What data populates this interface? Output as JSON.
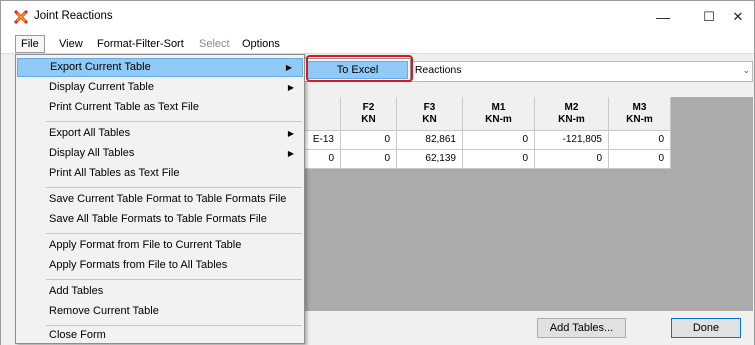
{
  "window": {
    "title": "Joint Reactions",
    "minimize_glyph": "—",
    "maximize_glyph": "☐",
    "close_glyph": "✕"
  },
  "menubar": {
    "items": [
      "File",
      "View",
      "Format-Filter-Sort",
      "Select",
      "Options"
    ]
  },
  "file_menu": {
    "items": [
      {
        "label": "Export Current Table",
        "has_submenu": true
      },
      {
        "label": "Display Current Table",
        "has_submenu": true
      },
      {
        "label": "Print Current Table as Text File",
        "has_submenu": false
      },
      {
        "label": "Export All Tables",
        "has_submenu": true
      },
      {
        "label": "Display All Tables",
        "has_submenu": true
      },
      {
        "label": "Print All Tables as Text File",
        "has_submenu": false
      },
      {
        "label": "Save Current Table Format to Table Formats File",
        "has_submenu": false
      },
      {
        "label": "Save All Table Formats to Table Formats File",
        "has_submenu": false
      },
      {
        "label": "Apply Format from File to Current Table",
        "has_submenu": false
      },
      {
        "label": "Apply Formats from File to All Tables",
        "has_submenu": false
      },
      {
        "label": "Add Tables",
        "has_submenu": false
      },
      {
        "label": "Remove Current Table",
        "has_submenu": false
      },
      {
        "label": "Close Form",
        "has_submenu": false
      }
    ],
    "submenu_arrow": "▶"
  },
  "submenu": {
    "item": "To Excel"
  },
  "table_selector": {
    "value": "t Reactions",
    "arrow": "⌄"
  },
  "grid": {
    "headers": [
      {
        "name": "F2",
        "unit": "KN"
      },
      {
        "name": "F3",
        "unit": "KN"
      },
      {
        "name": "M1",
        "unit": "KN-m"
      },
      {
        "name": "M2",
        "unit": "KN-m"
      },
      {
        "name": "M3",
        "unit": "KN-m"
      }
    ],
    "partial_column_values": [
      "E-13",
      "0"
    ],
    "rows": [
      [
        "0",
        "82,861",
        "0",
        "-121,805",
        "0"
      ],
      [
        "0",
        "62,139",
        "0",
        "0",
        "0"
      ]
    ]
  },
  "buttons": {
    "add_tables": "Add Tables...",
    "done": "Done"
  },
  "colors": {
    "menu_highlight": "#91c9f7",
    "red_outline": "#e0141e",
    "grid_background": "#ababab"
  }
}
